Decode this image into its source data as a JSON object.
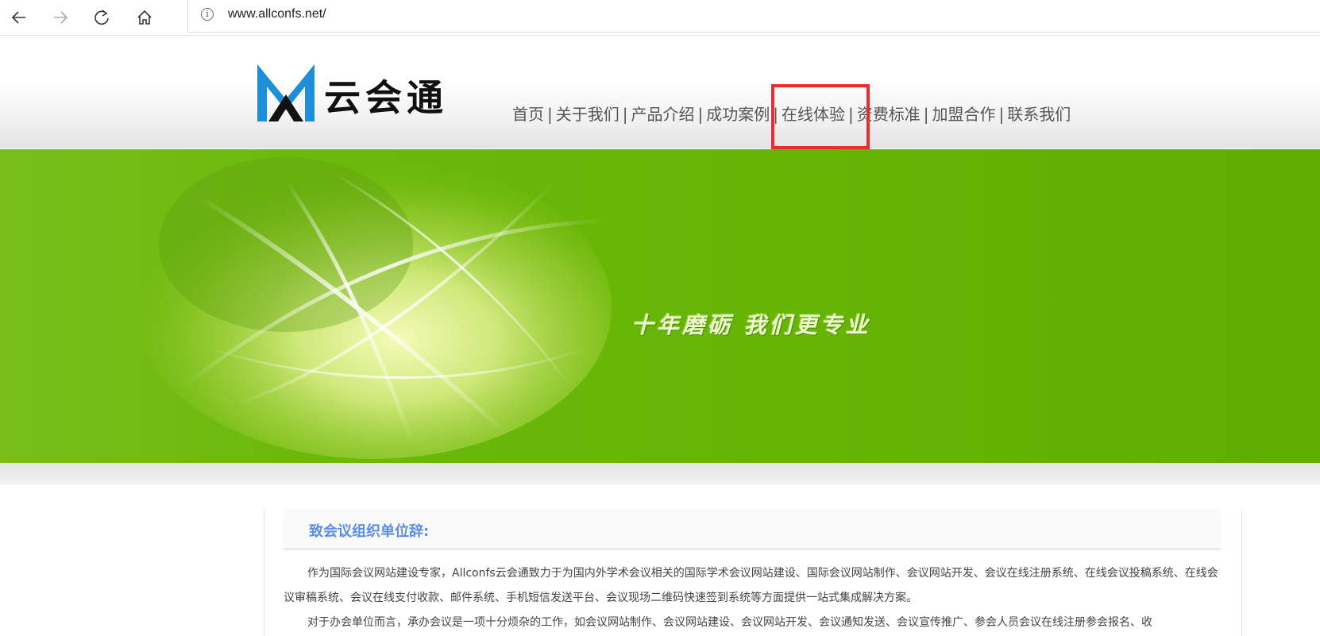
{
  "browser": {
    "url": "www.allconfs.net/",
    "icons": [
      "back-icon",
      "forward-icon",
      "refresh-icon",
      "home-icon",
      "info-icon"
    ]
  },
  "header": {
    "logo_text": "云会通",
    "nav": [
      "首页",
      "关于我们",
      "产品介绍",
      "成功案例",
      "在线体验",
      "资费标准",
      "加盟合作",
      "联系我们"
    ],
    "separator": "|"
  },
  "banner": {
    "slogan": "十年磨砺 我们更专业"
  },
  "content": {
    "title": "致会议组织单位辞:",
    "paragraphs": [
      "作为国际会议网站建设专家，Allconfs云会通致力于为国内外学术会议相关的国际学术会议网站建设、国际会议网站制作、会议网站开发、会议在线注册系统、在线会议投稿系统、在线会议审稿系统、会议在线支付收款、邮件系统、手机短信发送平台、会议现场二维码快速签到系统等方面提供一站式集成解决方案。",
      "对于办会单位而言，承办会议是一项十分烦杂的工作，如会议网站制作、会议网站建设、会议网站开发、会议通知发送、会议宣传推广、参会人员会议在线注册参会报名、收"
    ]
  },
  "colors": {
    "banner_green": "#66b404",
    "title_blue": "#5b8ee6",
    "highlight_red": "#ee2a2a",
    "logo_blue": "#1e8ed8"
  }
}
